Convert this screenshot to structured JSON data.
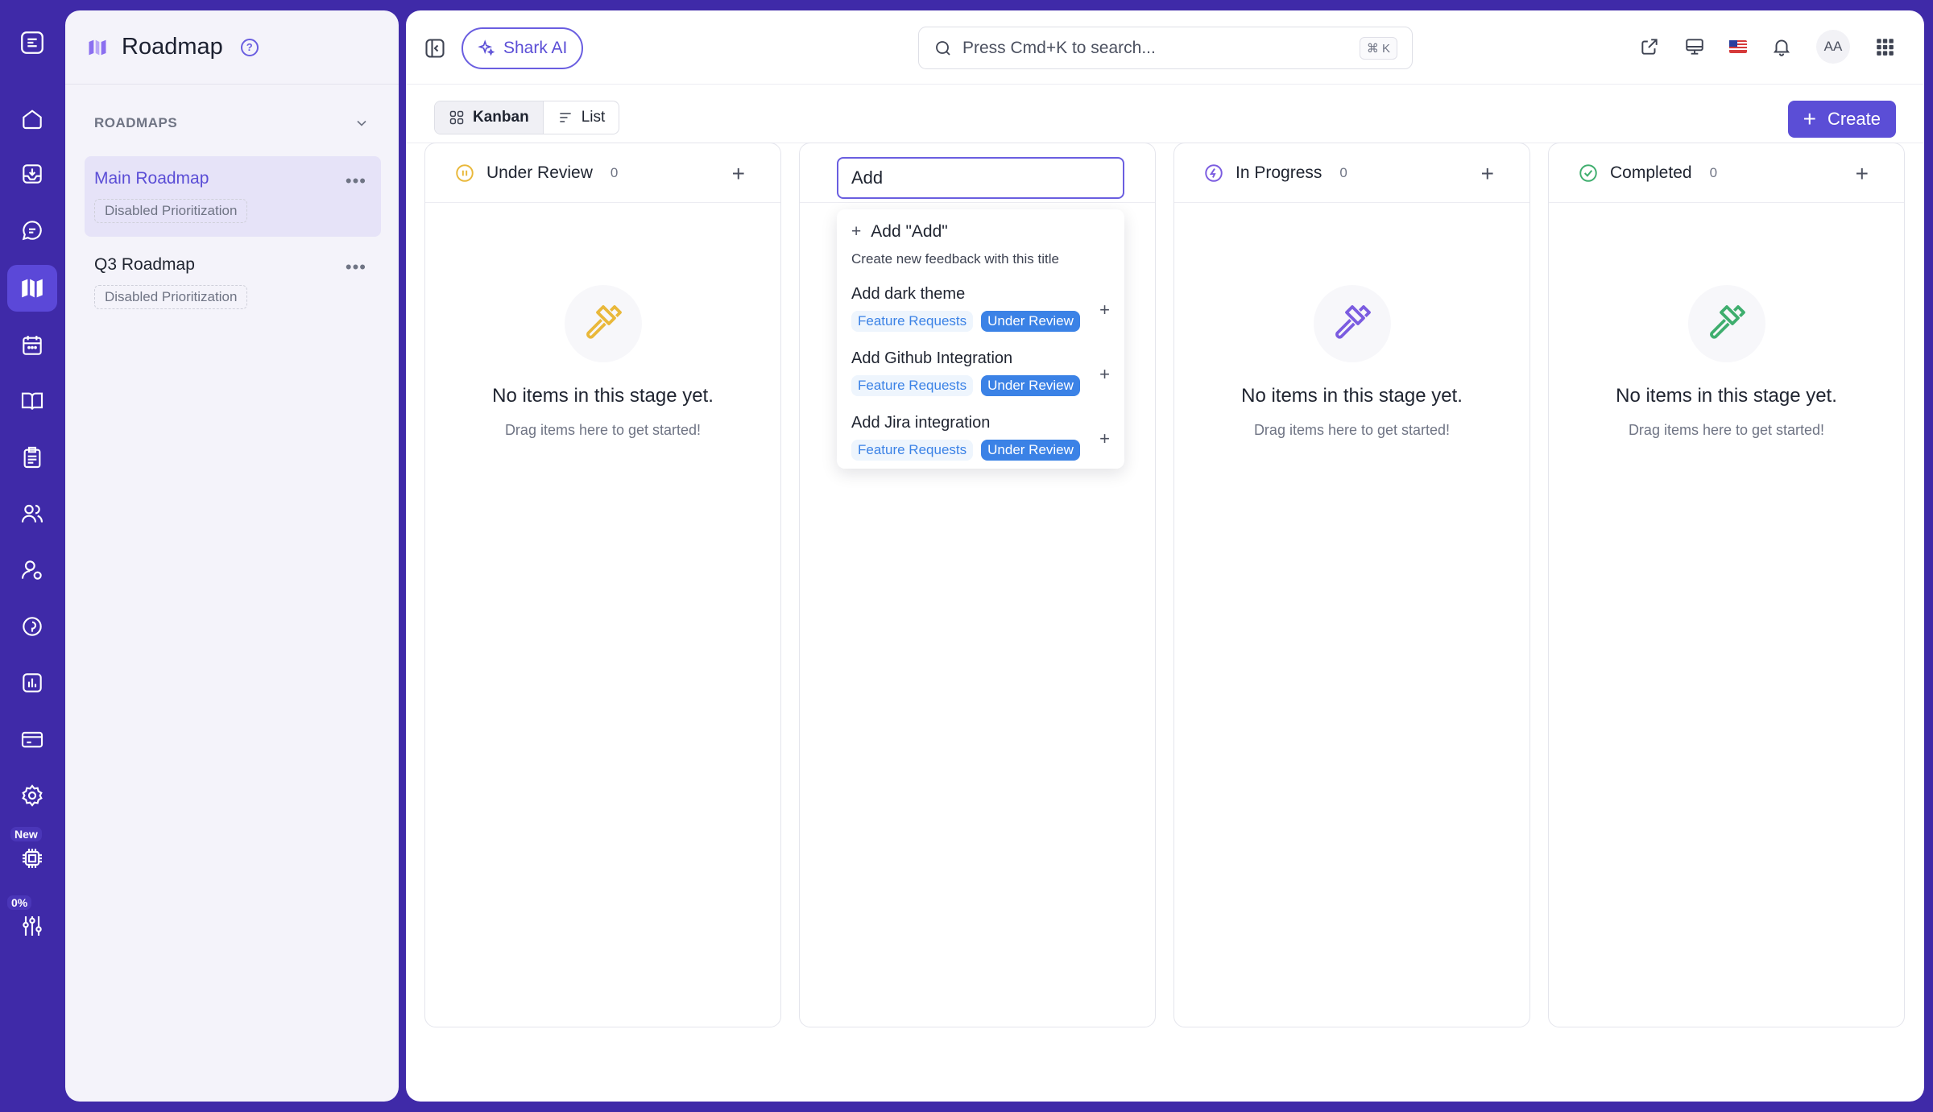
{
  "rail": {
    "items": [
      {
        "icon": "collapse-nav-icon"
      },
      {
        "icon": "home-icon"
      },
      {
        "icon": "inbox-icon"
      },
      {
        "icon": "chat-icon"
      },
      {
        "icon": "roadmap-icon",
        "active": true
      },
      {
        "icon": "calendar-icon"
      },
      {
        "icon": "book-icon"
      },
      {
        "icon": "clipboard-icon"
      },
      {
        "icon": "users-icon"
      },
      {
        "icon": "user-settings-icon"
      },
      {
        "icon": "location-pin-icon"
      },
      {
        "icon": "analytics-icon"
      },
      {
        "icon": "billing-card-icon"
      },
      {
        "icon": "settings-gear-icon"
      },
      {
        "icon": "chip-icon",
        "badge": "New"
      },
      {
        "icon": "sliders-icon",
        "badge": "0%"
      }
    ],
    "new_badge": "New",
    "progress_badge": "0%"
  },
  "sidebar": {
    "title": "Roadmap",
    "help": "?",
    "section_label": "ROADMAPS",
    "roadmaps": [
      {
        "name": "Main Roadmap",
        "chip": "Disabled Prioritization",
        "active": true
      },
      {
        "name": "Q3 Roadmap",
        "chip": "Disabled Prioritization",
        "active": false
      }
    ]
  },
  "topbar": {
    "shark_ai_label": "Shark AI",
    "search_placeholder": "Press Cmd+K to search...",
    "search_shortcut": "⌘ K",
    "avatar_initials": "AA"
  },
  "viewbar": {
    "kanban_label": "Kanban",
    "list_label": "List",
    "create_label": "Create"
  },
  "columns": [
    {
      "title": "Under Review",
      "count": "0",
      "empty_title": "No items in this stage yet.",
      "empty_sub": "Drag items here to get started!",
      "color": "#e9b83a"
    },
    {
      "title": "",
      "count": "",
      "editing": true
    },
    {
      "title": "In Progress",
      "count": "0",
      "empty_title": "No items in this stage yet.",
      "empty_sub": "Drag items here to get started!",
      "color": "#7b5ce0"
    },
    {
      "title": "Completed",
      "count": "0",
      "empty_title": "No items in this stage yet.",
      "empty_sub": "Drag items here to get started!",
      "color": "#3fae6e"
    }
  ],
  "new_item": {
    "input_value": "Add",
    "add_option": "Add \"Add\"",
    "add_option_sub": "Create new feedback with this title",
    "suggestions": [
      {
        "title": "Add dark theme",
        "board": "Feature Requests",
        "status": "Under Review"
      },
      {
        "title": "Add Github Integration",
        "board": "Feature Requests",
        "status": "Under Review"
      },
      {
        "title": "Add Jira integration",
        "board": "Feature Requests",
        "status": "Under Review"
      }
    ]
  },
  "colors": {
    "frame": "#3f2aa8",
    "accent": "#5b4ed6",
    "tag_blue": "#3b82e6"
  }
}
